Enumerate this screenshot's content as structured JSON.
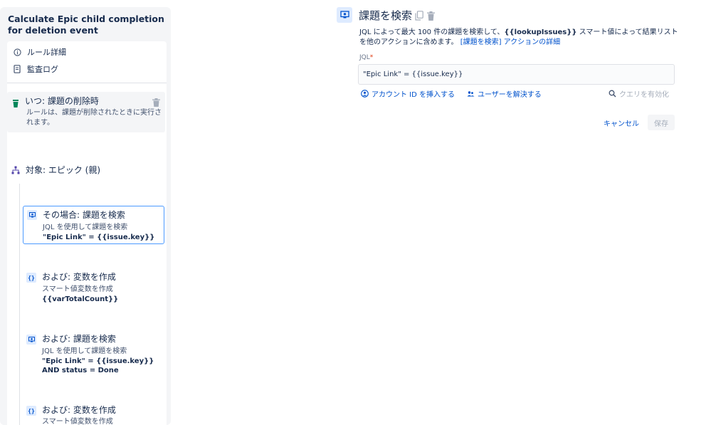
{
  "rule": {
    "title": "Calculate Epic child completion for deletion event",
    "nav": [
      {
        "label": "ルール詳細",
        "icon": "info-icon"
      },
      {
        "label": "監査ログ",
        "icon": "document-icon"
      }
    ]
  },
  "trigger": {
    "title": "いつ: 課題の削除時",
    "desc": "ルールは、課題が削除されたときに実行されます。"
  },
  "branch": {
    "label": "対象: エピック (親)"
  },
  "actions": [
    {
      "title": "その場合: 課題を検索",
      "sub": "JQL を使用して課題を検索",
      "detail": "\"Epic Link\" = {{issue.key}}",
      "icon": "lookup-icon"
    },
    {
      "title": "および: 変数を作成",
      "sub": "スマート値変数を作成",
      "detail": "{{varTotalCount}}",
      "icon": "braces-icon"
    },
    {
      "title": "および: 課題を検索",
      "sub": "JQL を使用して課題を検索",
      "detail": "\"Epic Link\" = {{issue.key}} AND status = Done",
      "icon": "lookup-icon"
    },
    {
      "title": "および: 変数を作成",
      "sub": "スマート値変数を作成",
      "detail": "",
      "icon": "braces-icon"
    }
  ],
  "panel": {
    "title": "課題を検索",
    "desc_pre": "JQL によって最大 100 件の課題を検索して、",
    "desc_smart": "{{lookupIssues}}",
    "desc_post": " スマート値によって結果リストを他のアクションに含めます。",
    "desc_link": "[課題を検索] アクションの詳細",
    "jql_label": "JQL",
    "jql_required": "*",
    "jql_value": "\"Epic Link\" = {{issue.key}}",
    "helpers": {
      "insert_account": "アカウント ID を挿入する",
      "resolve_users": "ユーザーを解決する",
      "validate_query": "クエリを有効化"
    },
    "cancel_label": "キャンセル",
    "save_label": "保存"
  },
  "colors": {
    "accent": "#0052cc",
    "trigger_green": "#00875a",
    "selected_border": "#4c9aff"
  }
}
